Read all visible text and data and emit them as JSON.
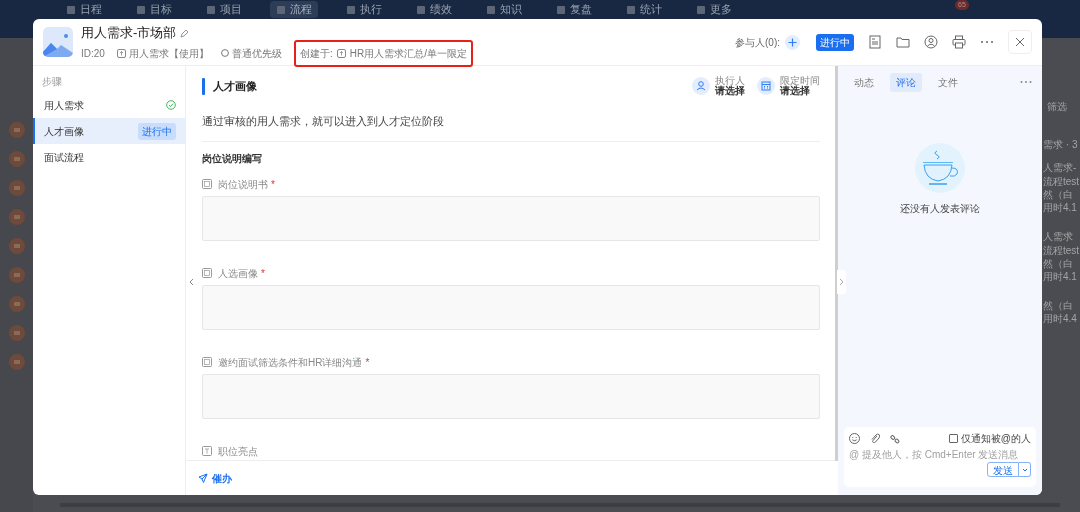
{
  "app_nav": {
    "items": [
      {
        "label": "日程",
        "selected": false
      },
      {
        "label": "目标",
        "selected": false
      },
      {
        "label": "项目",
        "selected": false
      },
      {
        "label": "流程",
        "selected": true
      },
      {
        "label": "执行",
        "selected": false
      },
      {
        "label": "绩效",
        "selected": false
      },
      {
        "label": "知识",
        "selected": false
      },
      {
        "label": "复盘",
        "selected": false
      },
      {
        "label": "统计",
        "selected": false
      },
      {
        "label": "更多",
        "selected": false
      }
    ],
    "badge": "65"
  },
  "background_list": {
    "filter": "筛选",
    "group": "需求 · 3",
    "items": [
      {
        "title": "人需求-",
        "lines": [
          "流程test",
          "然（白",
          "用时4.1"
        ]
      },
      {
        "title": "人需求",
        "lines": [
          "流程test",
          "然（白",
          "用时4.1"
        ]
      },
      {
        "lines": [
          "然（白",
          "用时4.4"
        ]
      }
    ]
  },
  "modal": {
    "header": {
      "title": "用人需求-市场部",
      "id": "ID:20",
      "template": "用人需求【使用】",
      "priority": "普通优先级",
      "created_label": "创建于:",
      "created_from": "HR用人需求汇总/单一限定",
      "highlighted": true,
      "participants": "参与人(0):",
      "status": "进行中"
    },
    "steps": {
      "title": "步骤",
      "items": [
        {
          "label": "用人需求",
          "kind": "done",
          "selected": false
        },
        {
          "label": "人才画像",
          "kind": "active",
          "badge": "进行中",
          "selected": true
        },
        {
          "label": "面试流程",
          "kind": "pending",
          "selected": false
        }
      ]
    },
    "main": {
      "section": "人才画像",
      "executor": {
        "label": "执行人",
        "value": "请选择"
      },
      "deadline": {
        "label": "限定时间",
        "value": "请选择"
      },
      "description": "通过审核的用人需求，就可以进入到人才定位阶段",
      "group": "岗位说明编写",
      "fields": [
        {
          "label": "岗位说明书",
          "required": true,
          "kind": "textarea"
        },
        {
          "label": "人选画像",
          "required": true,
          "kind": "textarea"
        },
        {
          "label": "邀约面试筛选条件和HR详细沟通",
          "required": true,
          "kind": "textarea"
        },
        {
          "label": "职位亮点",
          "required": false,
          "kind": "text"
        }
      ],
      "required_mark": "*",
      "urge": "催办"
    },
    "comments": {
      "tabs": [
        {
          "label": "动态",
          "selected": false
        },
        {
          "label": "评论",
          "selected": true
        },
        {
          "label": "文件",
          "selected": false
        }
      ],
      "empty": "还没有人发表评论",
      "notify_only": {
        "label": "仅通知被@的人",
        "checked": false
      },
      "placeholder": "@ 提及他人，按 Cmd+Enter 发送消息",
      "send": "发送"
    }
  }
}
